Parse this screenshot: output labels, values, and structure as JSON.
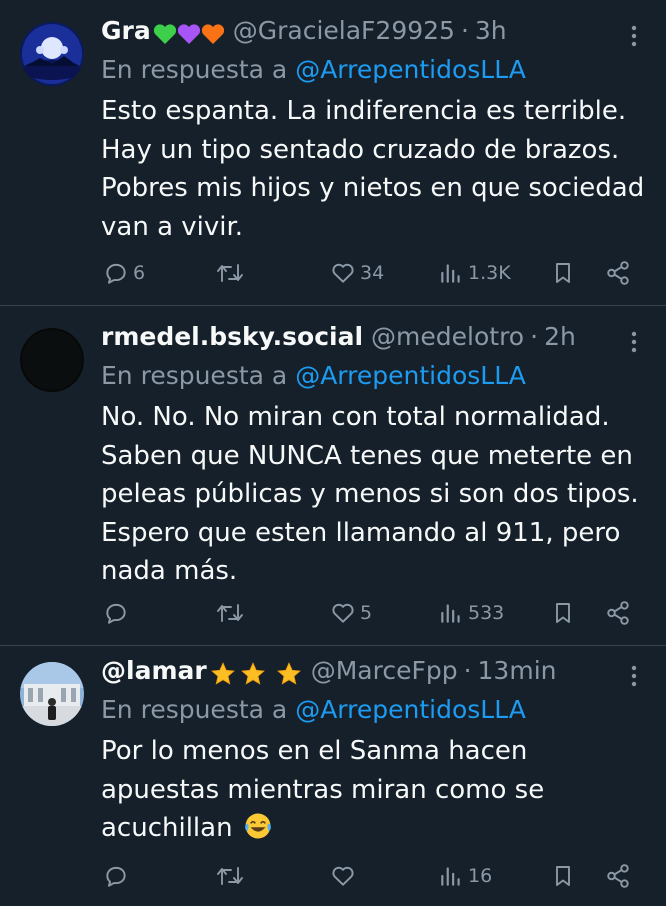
{
  "reply_prefix": "En respuesta a",
  "tweets": [
    {
      "name": "Gra",
      "name_suffix_icons": [
        "green-heart-emoji",
        "purple-heart-emoji",
        "orange-heart-emoji"
      ],
      "handle": "@GracielaF29925",
      "separator": "·",
      "time": "3h",
      "reply_to": "@ArrepentidosLLA",
      "text": "Esto espanta. La indiferencia es terrible. Hay un tipo sentado cruzado de brazos. Pobres mis hijos y nietos en que sociedad van a vivir.",
      "replies": "6",
      "retweets": "",
      "likes": "34",
      "views": "1.3K"
    },
    {
      "name": "rmedel.bsky.social",
      "handle": "@medelotro",
      "separator": "·",
      "time": "2h",
      "reply_to": "@ArrepentidosLLA",
      "text": "No. No. No miran con total normalidad. Saben que NUNCA tenes que meterte en peleas públicas y menos si son dos tipos. Espero que esten llamando al 911, pero nada más.",
      "replies": "",
      "retweets": "",
      "likes": "5",
      "views": "533"
    },
    {
      "name": "@lamar",
      "name_suffix_icons": [
        "star-emoji",
        "star-emoji",
        "star-emoji"
      ],
      "handle": "@MarceFpp",
      "separator": "·",
      "time": "13min",
      "reply_to": "@ArrepentidosLLA",
      "text": "Por lo menos en el Sanma  hacen apuestas mientras miran como se acuchillan",
      "text_emoji": "tears-of-joy-emoji",
      "replies": "",
      "retweets": "",
      "likes": "",
      "views": "16"
    }
  ],
  "colors": {
    "background": "#15202b",
    "text": "#f7f9f9",
    "muted": "#8b98a5",
    "link": "#1d9bf0",
    "divider": "#38444d"
  }
}
